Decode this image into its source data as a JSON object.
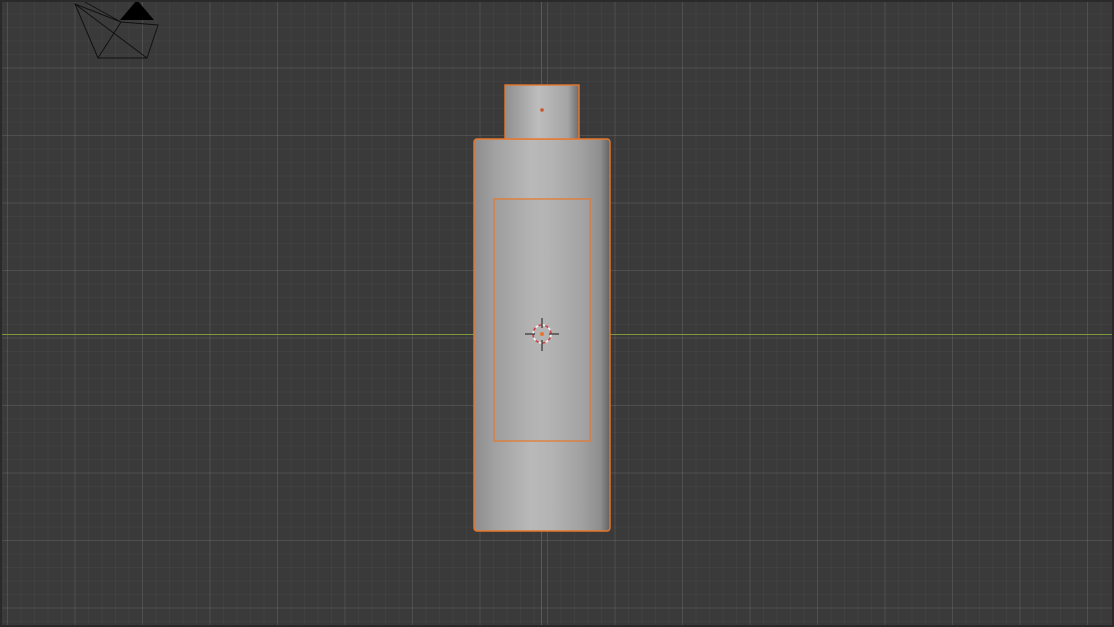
{
  "viewport": {
    "view": "front-orthographic",
    "background_color": "#3a3a3a",
    "x_axis_color": "#7c9a3a",
    "z_axis_color": "#3d5c98"
  },
  "scene": {
    "objects": [
      {
        "name": "bottle-body",
        "selected": true
      },
      {
        "name": "bottle-cap",
        "selected": true
      },
      {
        "name": "label-panel",
        "selected": true
      },
      {
        "name": "camera",
        "selected": false
      }
    ],
    "selection_outline_color": "#e8762b",
    "mesh_color": "#a8a8a8"
  },
  "icons": {
    "camera": "camera-icon",
    "cursor": "3d-cursor-icon",
    "origin": "object-origin-icon"
  }
}
